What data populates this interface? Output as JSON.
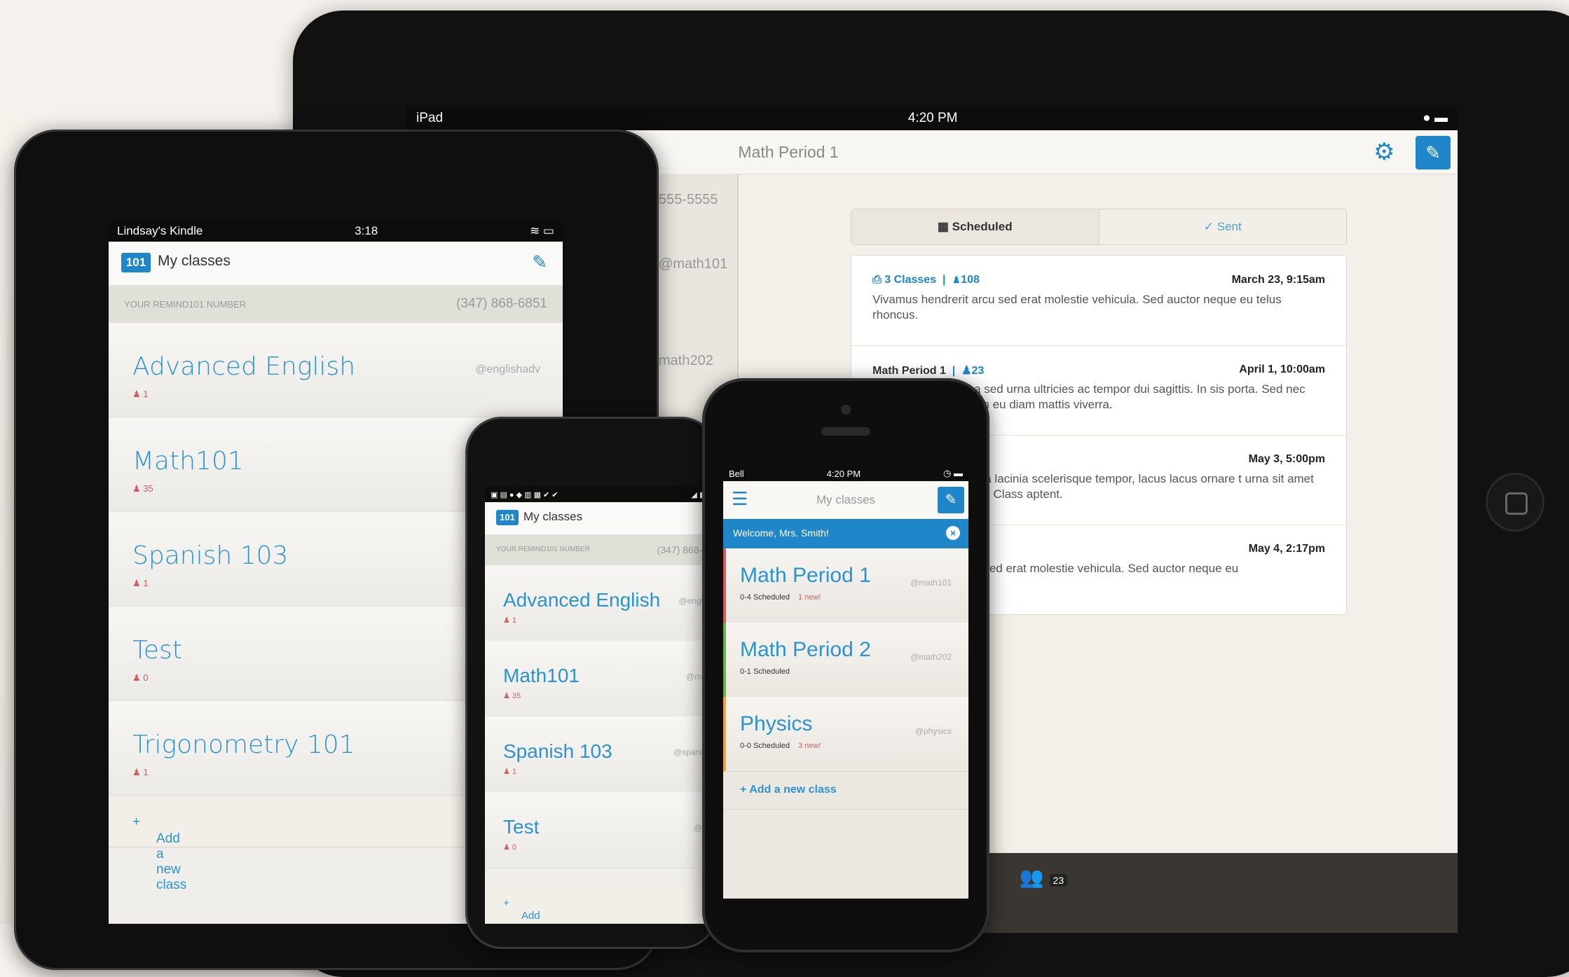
{
  "ipad": {
    "status": {
      "device": "iPad",
      "time": "4:20 PM"
    },
    "title": "Math Period 1",
    "left_rows": [
      "555-5555",
      "@math101",
      "math202"
    ],
    "segment": {
      "scheduled": "Scheduled",
      "sent": "Sent"
    },
    "messages": [
      {
        "to": "3 Classes",
        "count": "108",
        "date": "March 23, 9:15am",
        "body": "Vivamus hendrerit arcu sed erat molestie vehicula. Sed auctor neque eu telus rhoncus."
      },
      {
        "to": "Math Period 1",
        "count": "23",
        "date": "April 1, 10:00am",
        "body": "rna sed urna ultricies ac tempor dui sagittis. In sis porta. Sed nec diam eu diam mattis viverra."
      },
      {
        "to": "",
        "count": "",
        "date": "May 3, 5:00pm",
        "body": "ligula lacinia scelerisque tempor, lacus lacus ornare t urna sit amet arcu. Class aptent."
      },
      {
        "to": "",
        "count": "",
        "date": "May 4, 2:17pm",
        "body": "rcu sed erat molestie vehicula. Sed auctor neque eu"
      }
    ],
    "tab_badge": "23"
  },
  "kindle": {
    "status": {
      "device": "Lindsay's Kindle",
      "time": "3:18"
    },
    "title": "My classes",
    "logo": "101",
    "number_label": "YOUR REMIND101 NUMBER",
    "number": "(347) 868-6851",
    "classes": [
      {
        "name": "Advanced English",
        "count": "1",
        "handle": "@englishadv"
      },
      {
        "name": "Math101",
        "count": "35",
        "handle": ""
      },
      {
        "name": "Spanish 103",
        "count": "1",
        "handle": ""
      },
      {
        "name": "Test",
        "count": "0",
        "handle": ""
      },
      {
        "name": "Trigonometry 101",
        "count": "1",
        "handle": ""
      }
    ],
    "add_class": "Add a new class"
  },
  "android": {
    "title": "My classes",
    "logo": "101",
    "number_label": "YOUR REMIND101 NUMBER",
    "number": "(347) 868-6",
    "classes": [
      {
        "name": "Advanced English",
        "count": "1",
        "handle": "@englishad"
      },
      {
        "name": "Math101",
        "count": "35",
        "handle": "@math"
      },
      {
        "name": "Spanish 103",
        "count": "1",
        "handle": "@spanish10"
      },
      {
        "name": "Test",
        "count": "0",
        "handle": "@tes"
      }
    ],
    "add_class": "Add a new class"
  },
  "iphone": {
    "status": {
      "carrier": "Bell",
      "time": "4:20 PM"
    },
    "title": "My classes",
    "welcome": "Welcome, Mrs. Smith!",
    "classes": [
      {
        "name": "Math Period 1",
        "sub": "0-4 Scheduled",
        "new": "1 new!",
        "handle": "@math101",
        "edge": "#d85b5b"
      },
      {
        "name": "Math Period 2",
        "sub": "0-1 Scheduled",
        "new": "",
        "handle": "@math202",
        "edge": "#6db33f"
      },
      {
        "name": "Physics",
        "sub": "0-0 Scheduled",
        "new": "3 new!",
        "handle": "@physics",
        "edge": "#f2a33a"
      }
    ],
    "add_class": "+ Add a new class"
  },
  "colors": {
    "accent": "#1f86c9",
    "text_blue": "#2c93d0",
    "alert": "#d85b5b"
  }
}
